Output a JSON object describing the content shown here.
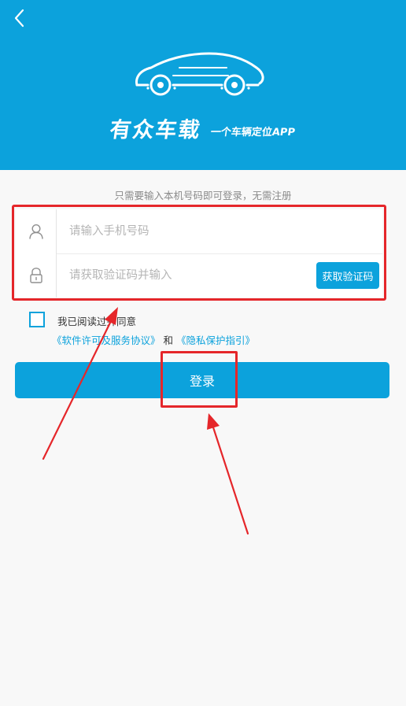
{
  "header": {
    "brand_name": "有众车载",
    "tagline": "一个车辆定位APP",
    "background_color": "#0ca2dc"
  },
  "form": {
    "hint": "只需要输入本机号码即可登录，无需注册",
    "phone_placeholder": "请输入手机号码",
    "code_placeholder": "请获取验证码并输入",
    "get_code_label": "获取验证码"
  },
  "agreement": {
    "text": "我已阅读过并同意",
    "link_terms": "《软件许可及服务协议》",
    "conjunction": "和",
    "link_privacy": "《隐私保护指引》",
    "checked": false
  },
  "login_label": "登录",
  "icons": {
    "back": "chevron-left-icon",
    "logo": "car-icon",
    "phone": "user-icon",
    "code": "lock-icon"
  },
  "colors": {
    "accent": "#0ca2dc",
    "annotation": "#e5262a"
  }
}
